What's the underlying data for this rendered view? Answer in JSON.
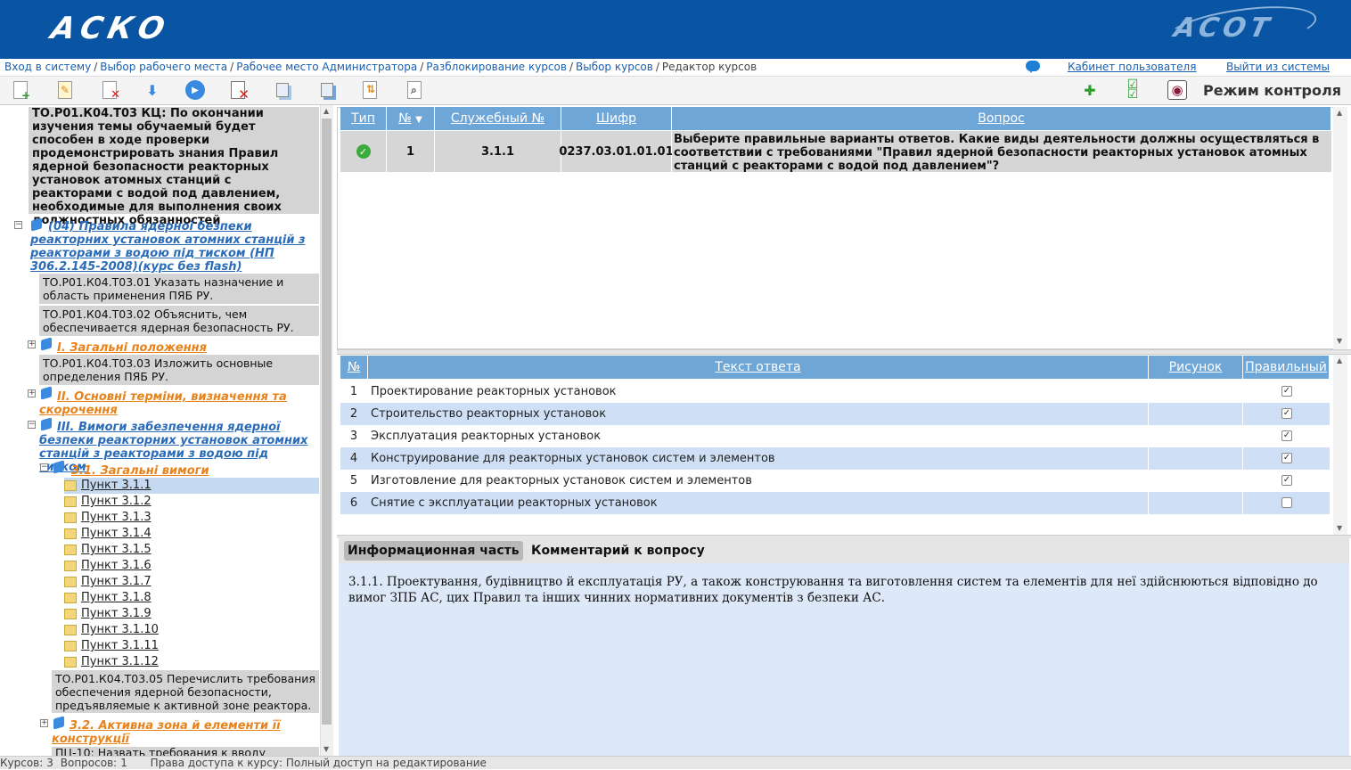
{
  "header": {
    "logo_left": "АСКО",
    "logo_right": "ACOT"
  },
  "breadcrumb": [
    "Вход в систему",
    "Выбор рабочего места",
    "Рабочее место Администратора",
    "Разблокирование курсов",
    "Выбор курсов",
    "Редактор курсов"
  ],
  "breadcrumb_sep": "/",
  "user_links": {
    "cabinet": "Кабинет пользователя",
    "logout": "Выйти из системы"
  },
  "toolbar": {
    "mode_label": "Режим контроля"
  },
  "tree": {
    "top_block": "ТО.Р01.К04.Т03 КЦ: По окончании изучения темы обучаемый будет способен в ходе проверки продемонстрировать знания Правил ядерной безопасности реакторных установок атомных станций с реакторами с водой под давлением, необходимые для выполнения своих должностных обязанностей",
    "course": "(04) Правила ядерної безпеки реакторних установок атомних станцій з реакторами з водою під тиском (НП 306.2.145-2008)(курс без flash)",
    "t01": "ТО.Р01.К04.Т03.01 Указать назначение и область применения ПЯБ РУ.",
    "t02": "ТО.Р01.К04.Т03.02 Объяснить, чем обеспечивается ядерная безопасность РУ.",
    "sec1": "І. Загальні положення",
    "t03": "ТО.Р01.К04.Т03.03 Изложить основные определения ПЯБ РУ.",
    "sec2": "ІІ. Основні терміни, визначення та скорочення",
    "sec3": "ІІІ. Вимоги забезпечення ядерної безпеки реакторних установок атомних станцій з реакторами з водою під тиском",
    "sub31": "3.1. Загальні вимоги",
    "punkts": [
      "Пункт 3.1.1",
      "Пункт 3.1.2",
      "Пункт 3.1.3",
      "Пункт 3.1.4",
      "Пункт 3.1.5",
      "Пункт 3.1.6",
      "Пункт 3.1.7",
      "Пункт 3.1.8",
      "Пункт 3.1.9",
      "Пункт 3.1.10",
      "Пункт 3.1.11",
      "Пункт 3.1.12"
    ],
    "t05": "ТО.Р01.К04.Т03.05 Перечислить требования обеспечения ядерной безопасности, предъявляемые к активной зоне реактора.",
    "sub32": "3.2. Активна зона й елементи її конструкції",
    "pc10": "ПЦ-10: Назвать требования к вводу"
  },
  "questions": {
    "headers": {
      "type": "Тип",
      "num": "№",
      "service_num": "Служебный №",
      "code": "Шифр",
      "question": "Вопрос"
    },
    "row": {
      "num": "1",
      "service_num": "3.1.1",
      "code": "0237.03.01.01.01",
      "text": "Выберите правильные варианты ответов. Какие виды деятельности должны осуществляться в соответствии с требованиями \"Правил ядерной безопасности реакторных установок атомных станций с реакторами с водой под давлением\"?"
    }
  },
  "answers": {
    "headers": {
      "num": "№",
      "text": "Текст ответа",
      "image": "Рисунок",
      "correct": "Правильный"
    },
    "rows": [
      {
        "num": "1",
        "text": "Проектирование реакторных установок",
        "correct": true
      },
      {
        "num": "2",
        "text": "Строительство реакторных установок",
        "correct": true
      },
      {
        "num": "3",
        "text": "Эксплуатация реакторных установок",
        "correct": true
      },
      {
        "num": "4",
        "text": "Конструирование для реакторных установок систем и элементов",
        "correct": true
      },
      {
        "num": "5",
        "text": "Изготовление для реакторных установок систем и элементов",
        "correct": true
      },
      {
        "num": "6",
        "text": "Снятие с эксплуатации реакторных установок",
        "correct": false
      }
    ]
  },
  "info": {
    "tab_info": "Информационная часть",
    "tab_comment": "Комментарий к вопросу",
    "text": "3.1.1. Проектування, будівництво й експлуатація РУ, а також конструювання та виготовлення систем та елементів для неї здійснюються відповідно до вимог ЗПБ АС, цих Правил та інших чинних нормативних документів з безпеки АС."
  },
  "status": {
    "courses_label": "Курсов:",
    "courses": "3",
    "questions_label": "Вопросов:",
    "questions": "1",
    "access": "Права доступа к курсу: Полный доступ на редактирование"
  },
  "colors": {
    "header": "#0a55a3",
    "grid_header": "#6fa6d8",
    "alt_row": "#cfe0f6",
    "link": "#1b5fae",
    "orange": "#e8821a"
  }
}
